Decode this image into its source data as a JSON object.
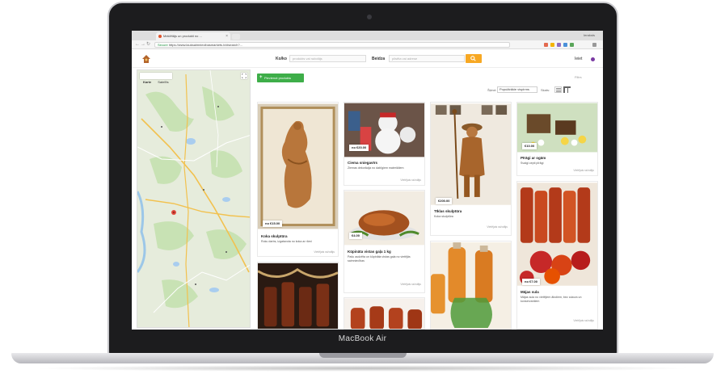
{
  "laptop": {
    "brand_label": "MacBook Air"
  },
  "browser": {
    "tab_title": "Meklētājs un produkti no ...",
    "tab_close": "×",
    "profile_name": "Ieraksts",
    "url_secure_label": "Secure",
    "url": "https://www.lauksaimniecibasmarkets.lv/#search?...",
    "nav_back": "←",
    "nav_forward": "→",
    "nav_reload": "↻"
  },
  "site_header": {
    "search_label": "Ko/ko",
    "search_placeholder": "produkts vai ražotājs",
    "where_label": "Beidza",
    "where_placeholder": "pilsēta vai adrese",
    "login_label": "Ieiet"
  },
  "map": {
    "tabs": [
      {
        "label": "Karte",
        "active": true
      },
      {
        "label": "Satelīts",
        "active": false
      }
    ]
  },
  "listing": {
    "add_button_label": "Pievienot produktu",
    "add_button_icon": "plus-icon",
    "top_right_text": "Filtrs",
    "sort_label": "Šķirot:",
    "sort_value": "Populārākie vispirms",
    "view_label": "Skats:",
    "cards": [
      {
        "price": "no €15.00",
        "title": "Koka skulptūra",
        "desc": "Roku darbs, izgatavota no koka ar rāmi",
        "meta": "Vietējais ražotājs"
      },
      {
        "price": "no €20.00",
        "title": "Ciema sniegavīrs",
        "desc": "Ziemas dekorācija no dabīgiem materiāliem",
        "meta": "Vietējais ražotājs"
      },
      {
        "price": "€10.00",
        "title": "Pīrāgi ar ogām",
        "desc": "Svaigi cepti pīrāgi",
        "meta": "Vietējais ražotājs"
      },
      {
        "price": "€4.00",
        "title": "Kūpināta vistas gaļa 1 kg",
        "desc": "Pašu audzēta un kūpināta vistas gaļa no vietējās saimniecības",
        "meta": "Vietējais ražotājs"
      },
      {
        "price": "€200.00",
        "title": "Tīklas skulptūra",
        "desc": "Koka skulptūra",
        "meta": "Vietējais ražotājs"
      },
      {
        "price": "no €7.00",
        "title": "Mājas sula",
        "desc": "Mājas sula no vietējiem āboliem, bez cukura un konservantiem",
        "meta": "Vietējais ražotājs"
      }
    ]
  },
  "colors": {
    "accent_green": "#3eae49",
    "search_orange": "#f7a823",
    "map_pin": "#e04a3c"
  }
}
